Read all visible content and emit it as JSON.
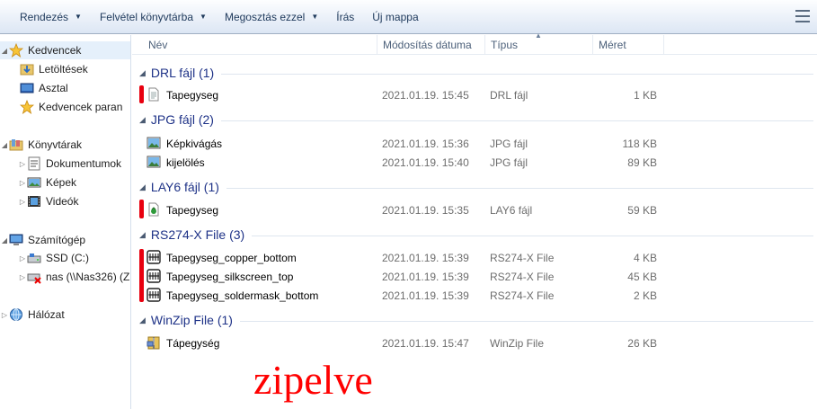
{
  "toolbar": {
    "organize": "Rendezés",
    "burn": "Felvétel könyvtárba",
    "share": "Megosztás ezzel",
    "write": "Írás",
    "new_folder": "Új mappa"
  },
  "sidebar": {
    "favorites": "Kedvencek",
    "downloads": "Letöltések",
    "desktop": "Asztal",
    "recent": "Kedvencek paran",
    "libraries": "Könyvtárak",
    "documents": "Dokumentumok",
    "pictures": "Képek",
    "videos": "Videók",
    "computer": "Számítógép",
    "ssd": "SSD (C:)",
    "nas": "nas (\\\\Nas326) (Z",
    "network": "Hálózat"
  },
  "columns": {
    "name": "Név",
    "modified": "Módosítás dátuma",
    "type": "Típus",
    "size": "Méret"
  },
  "groups": [
    {
      "label": "DRL fájl (1)",
      "files": [
        {
          "name": "Tapegyseg",
          "date": "2021.01.19. 15:45",
          "type": "DRL fájl",
          "size": "1 KB",
          "icon": "document-icon"
        }
      ]
    },
    {
      "label": "JPG fájl (2)",
      "files": [
        {
          "name": "Képkivágás",
          "date": "2021.01.19. 15:36",
          "type": "JPG fájl",
          "size": "118 KB",
          "icon": "image-file-icon"
        },
        {
          "name": "kijelölés",
          "date": "2021.01.19. 15:40",
          "type": "JPG fájl",
          "size": "89 KB",
          "icon": "image-file-icon"
        }
      ]
    },
    {
      "label": "LAY6 fájl (1)",
      "files": [
        {
          "name": "Tapegyseg",
          "date": "2021.01.19. 15:35",
          "type": "LAY6 fájl",
          "size": "59 KB",
          "icon": "layout-file-icon"
        }
      ]
    },
    {
      "label": "RS274-X File (3)",
      "files": [
        {
          "name": "Tapegyseg_copper_bottom",
          "date": "2021.01.19. 15:39",
          "type": "RS274-X File",
          "size": "4 KB",
          "icon": "gerber-file-icon"
        },
        {
          "name": "Tapegyseg_silkscreen_top",
          "date": "2021.01.19. 15:39",
          "type": "RS274-X File",
          "size": "45 KB",
          "icon": "gerber-file-icon"
        },
        {
          "name": "Tapegyseg_soldermask_bottom",
          "date": "2021.01.19. 15:39",
          "type": "RS274-X File",
          "size": "2 KB",
          "icon": "gerber-file-icon"
        }
      ]
    },
    {
      "label": "WinZip File (1)",
      "files": [
        {
          "name": "Tápegység",
          "date": "2021.01.19. 15:47",
          "type": "WinZip File",
          "size": "26 KB",
          "icon": "zip-archive-icon"
        }
      ]
    }
  ],
  "annotation": "zipelve",
  "colors": {
    "group_header": "#1e3287",
    "highlight_mark": "#e8000f",
    "annotation": "#ff0000"
  }
}
